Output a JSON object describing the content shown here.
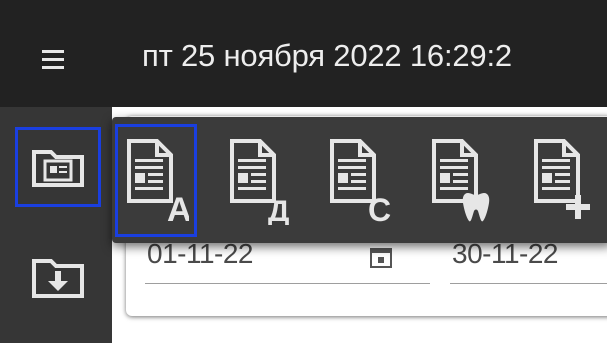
{
  "header": {
    "title": "пт 25 ноября 2022 16:29:2",
    "menu_icon": "menu-icon"
  },
  "sidebar": {
    "items": [
      {
        "name": "documents-folder",
        "icon": "folder-document-icon",
        "selected": true
      },
      {
        "name": "download-folder",
        "icon": "folder-download-icon",
        "selected": false
      }
    ]
  },
  "filters": {
    "date_from": "01-11-22",
    "date_to": "30-11-22",
    "calendar_icon": "calendar-icon"
  },
  "document_menu": {
    "items": [
      {
        "icon": "document-a-icon",
        "letter": "А",
        "selected": true
      },
      {
        "icon": "document-d-icon",
        "letter": "Д",
        "selected": false
      },
      {
        "icon": "document-c-icon",
        "letter": "С",
        "selected": false
      },
      {
        "icon": "document-tooth-icon",
        "letter": "",
        "selected": false
      },
      {
        "icon": "document-add-icon",
        "letter": "",
        "selected": false
      }
    ]
  },
  "colors": {
    "topbar": "#222222",
    "sidebar": "#363636",
    "popup": "#3b3b3b",
    "selection": "#1a3fe0",
    "icon": "#e6e6e6"
  }
}
